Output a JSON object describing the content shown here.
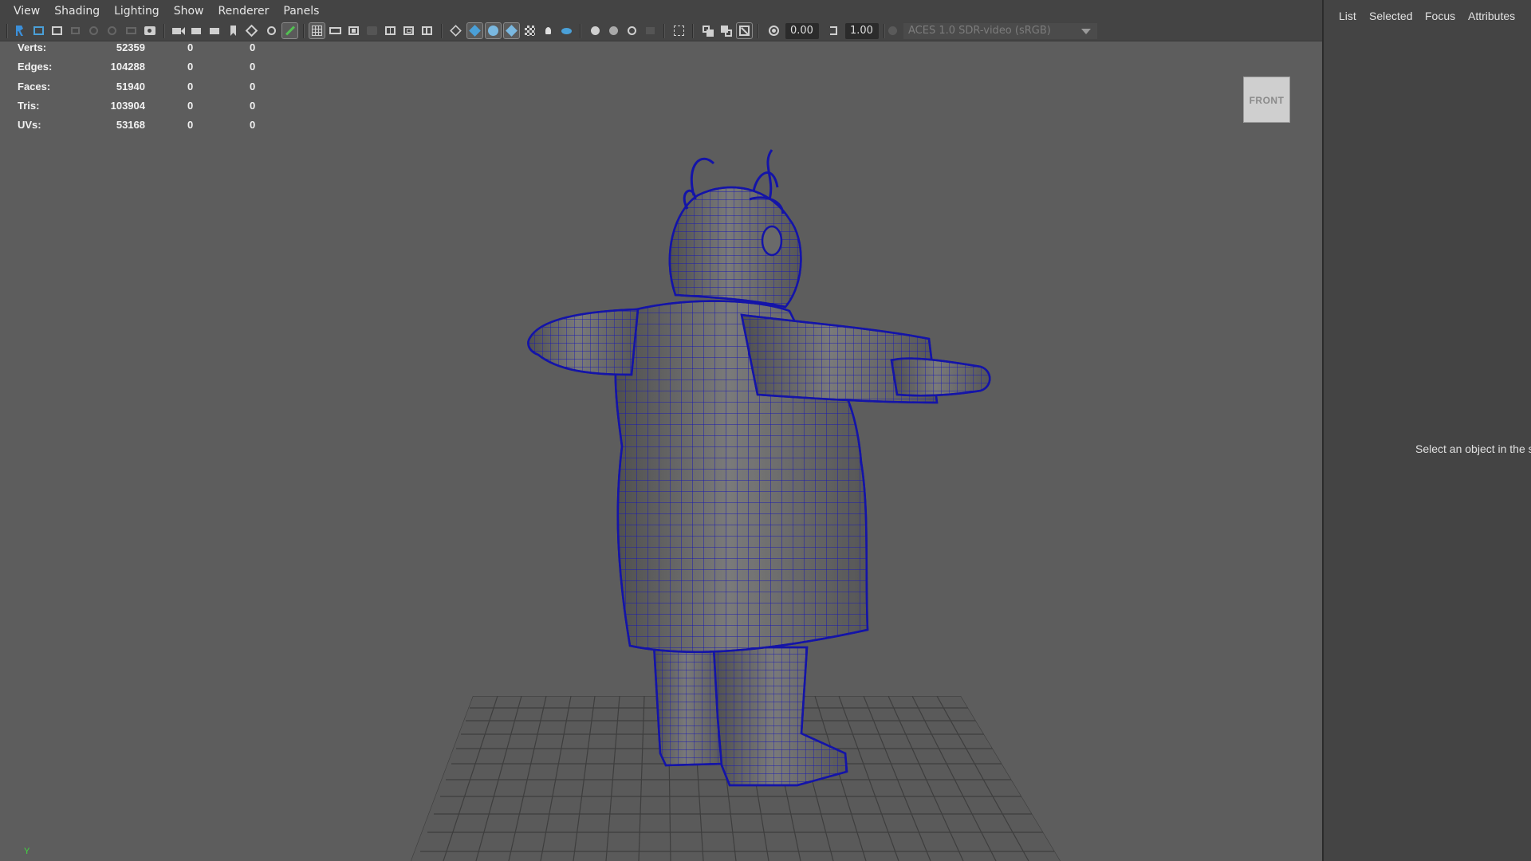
{
  "menu": [
    "View",
    "Shading",
    "Lighting",
    "Show",
    "Renderer",
    "Panels"
  ],
  "toolbar": {
    "exposure_value": "0.00",
    "gamma_value": "1.00",
    "color_space": "ACES 1.0 SDR-video (sRGB)",
    "icons": [
      "select-camera-icon",
      "camera-attributes-icon",
      "bookmark-icon",
      "image-plane-icon",
      "grease-pencil-icon",
      "grid-icon",
      "film-gate-icon",
      "resolution-gate-icon",
      "gate-mask-icon",
      "field-chart-icon",
      "safe-action-icon",
      "safe-title-icon",
      "wireframe-icon",
      "smooth-shade-icon",
      "wireframe-on-shaded-icon",
      "xray-icon",
      "textured-icon",
      "use-all-lights-icon",
      "shadows-icon",
      "screen-space-ao-icon",
      "motion-blur-icon",
      "antialiasing-icon",
      "depth-of-field-icon",
      "isolate-select-icon",
      "xray-joints-icon",
      "xray-active-icon",
      "backface-icon",
      "exposure-icon",
      "gamma-icon",
      "color-management-icon"
    ]
  },
  "hud": {
    "rows": [
      {
        "label": "Verts:",
        "v1": "52359",
        "v2": "0",
        "v3": "0"
      },
      {
        "label": "Edges:",
        "v1": "104288",
        "v2": "0",
        "v3": "0"
      },
      {
        "label": "Faces:",
        "v1": "51940",
        "v2": "0",
        "v3": "0"
      },
      {
        "label": "Tris:",
        "v1": "103904",
        "v2": "0",
        "v3": "0"
      },
      {
        "label": "UVs:",
        "v1": "53168",
        "v2": "0",
        "v3": "0"
      }
    ]
  },
  "viewcube": {
    "label": "FRONT"
  },
  "axis": {
    "label": "Y"
  },
  "right_panel": {
    "tabs": [
      "List",
      "Selected",
      "Focus",
      "Attributes"
    ],
    "message": "Select an object in the s"
  },
  "colors": {
    "wire": "#1a1ab0",
    "viewport_bg": "#5d5d5d",
    "panel_bg": "#444444",
    "active_icon": "#4aa0d8"
  }
}
